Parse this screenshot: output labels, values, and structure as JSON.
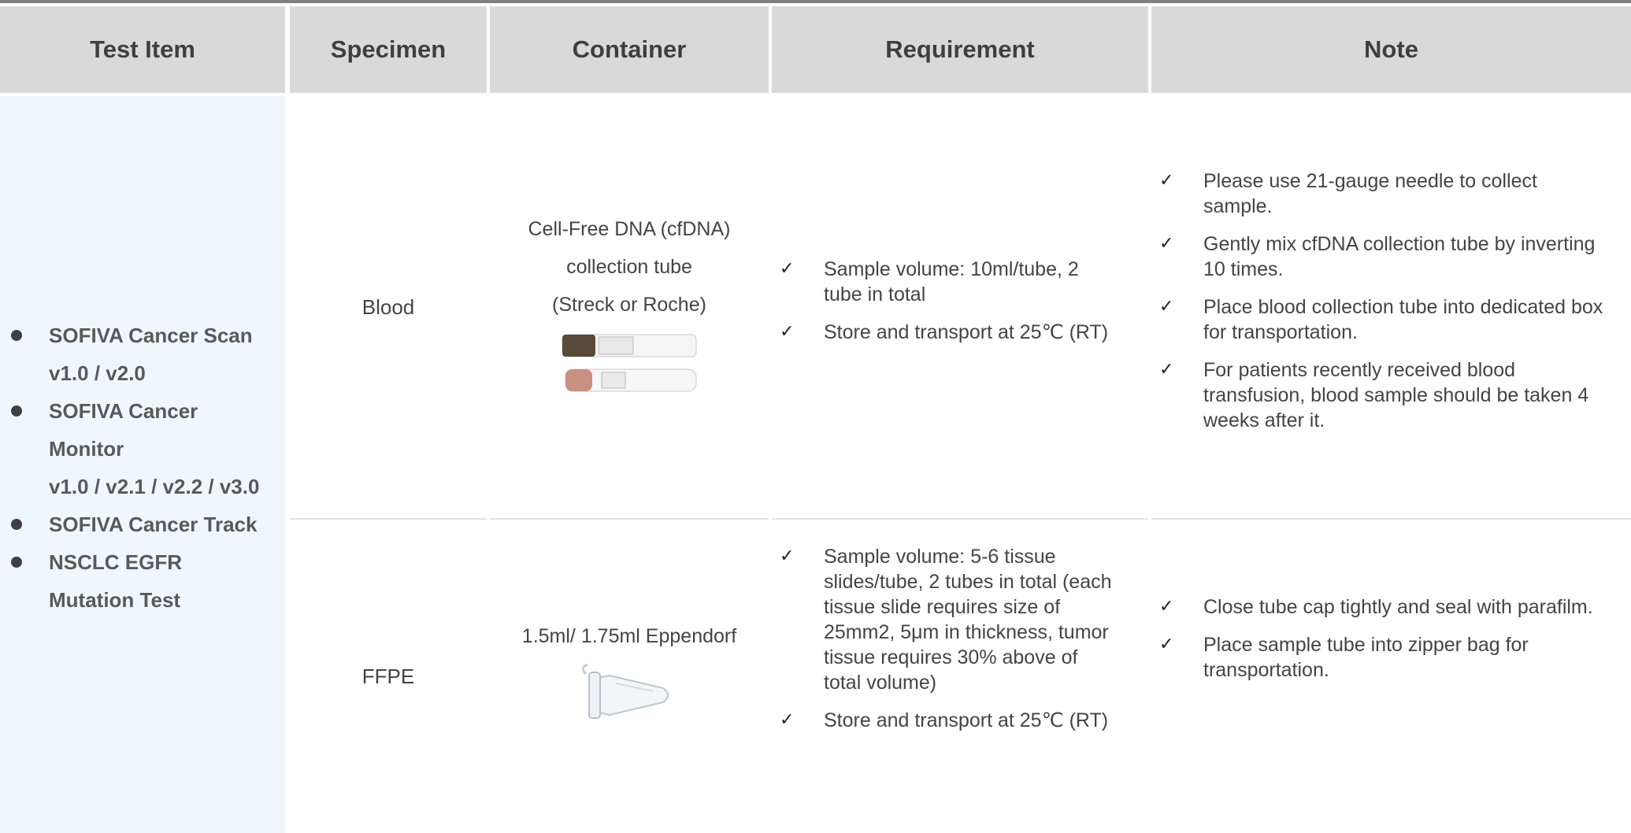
{
  "headers": [
    "Test Item",
    "Specimen",
    "Container",
    "Requirement",
    "Note"
  ],
  "test_items": [
    [
      "SOFIVA Cancer Scan",
      "v1.0 / v2.0"
    ],
    [
      "SOFIVA Cancer",
      "Monitor",
      "v1.0 / v2.1 / v2.2 / v3.0"
    ],
    [
      "SOFIVA Cancer Track"
    ],
    [
      "NSCLC EGFR",
      "Mutation Test"
    ]
  ],
  "rows": [
    {
      "specimen": "Blood",
      "container_lines": [
        "Cell-Free DNA (cfDNA)",
        "collection tube",
        "(Streck or Roche)"
      ],
      "requirement": [
        "Sample volume: 10ml/tube, 2 tube in total",
        "Store and transport at 25℃ (RT)"
      ],
      "note": [
        "Please use 21-gauge needle to collect sample.",
        "Gently mix cfDNA collection tube by inverting 10 times.",
        "Place blood collection tube into dedicated box for transportation.",
        "For patients recently received blood transfusion, blood sample should be taken 4 weeks after it."
      ]
    },
    {
      "specimen": "FFPE",
      "container_lines": [
        "1.5ml/ 1.75ml Eppendorf"
      ],
      "requirement": [
        "Sample volume: 5-6 tissue slides/tube, 2 tubes in total (each tissue slide requires size of 25mm2, 5μm in thickness, tumor tissue requires 30% above of total volume)",
        "Store and transport at 25℃ (RT)"
      ],
      "note": [
        "Close tube cap tightly and seal with parafilm.",
        "Place sample tube into zipper bag for transportation."
      ]
    }
  ],
  "checkmark": "✓",
  "icons": {
    "check": "check-mark-icon",
    "bullet": "bullet-dot-icon",
    "blood_tube": "blood-collection-tube-image",
    "eppendorf": "eppendorf-tube-image"
  },
  "colors": {
    "header_bg": "#d9d9d9",
    "test_item_bg": "#eef8fc",
    "top_rule": "#7f7f7f"
  }
}
